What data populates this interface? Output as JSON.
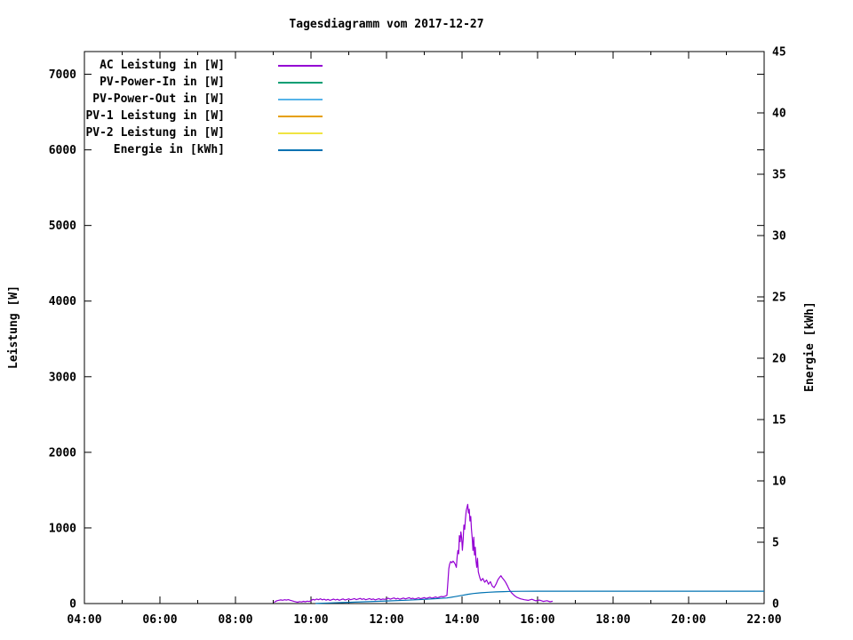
{
  "title": "Tagesdiagramm vom 2017-12-27",
  "chart_data": {
    "type": "line",
    "title": "Tagesdiagramm vom 2017-12-27",
    "x_axis": {
      "unit": "hour-of-day",
      "range": [
        4,
        22
      ],
      "major_hours": [
        4,
        6,
        8,
        10,
        12,
        14,
        16,
        18,
        20,
        22
      ],
      "major_labels": [
        "04:00",
        "06:00",
        "08:00",
        "10:00",
        "12:00",
        "14:00",
        "16:00",
        "18:00",
        "20:00",
        "22:00"
      ],
      "minor_hours": [
        5,
        7,
        9,
        11,
        13,
        15,
        17,
        19,
        21
      ]
    },
    "y1_axis": {
      "label": "Leistung [W]",
      "range": [
        0,
        7300
      ],
      "tick_values": [
        0,
        1000,
        2000,
        3000,
        4000,
        5000,
        6000,
        7000
      ],
      "tick_labels": [
        "0",
        "1000",
        "2000",
        "3000",
        "4000",
        "5000",
        "6000",
        "7000"
      ]
    },
    "y2_axis": {
      "label": "Energie [kWh]",
      "range": [
        0,
        45
      ],
      "tick_values": [
        0,
        5,
        10,
        15,
        20,
        25,
        30,
        35,
        40,
        45
      ],
      "tick_labels": [
        "0",
        "5",
        "10",
        "15",
        "20",
        "25",
        "30",
        "35",
        "40",
        "45"
      ]
    },
    "legend_position": "top-left-inside",
    "grid": false,
    "series": [
      {
        "name": "AC Leistung in [W]",
        "color": "#9400d3",
        "axis": "y1",
        "points": [
          [
            9.02,
            15
          ],
          [
            9.06,
            28
          ],
          [
            9.1,
            38
          ],
          [
            9.15,
            44
          ],
          [
            9.2,
            48
          ],
          [
            9.25,
            43
          ],
          [
            9.3,
            50
          ],
          [
            9.35,
            46
          ],
          [
            9.4,
            52
          ],
          [
            9.45,
            44
          ],
          [
            9.5,
            36
          ],
          [
            9.55,
            28
          ],
          [
            9.6,
            22
          ],
          [
            9.65,
            18
          ],
          [
            9.7,
            26
          ],
          [
            9.75,
            21
          ],
          [
            9.8,
            29
          ],
          [
            9.85,
            24
          ],
          [
            9.9,
            32
          ],
          [
            9.95,
            27
          ],
          [
            10.0,
            38
          ],
          [
            10.05,
            55
          ],
          [
            10.1,
            47
          ],
          [
            10.15,
            60
          ],
          [
            10.2,
            51
          ],
          [
            10.25,
            63
          ],
          [
            10.3,
            49
          ],
          [
            10.35,
            58
          ],
          [
            10.4,
            45
          ],
          [
            10.45,
            55
          ],
          [
            10.5,
            42
          ],
          [
            10.55,
            51
          ],
          [
            10.6,
            59
          ],
          [
            10.65,
            47
          ],
          [
            10.7,
            56
          ],
          [
            10.75,
            44
          ],
          [
            10.8,
            53
          ],
          [
            10.85,
            61
          ],
          [
            10.9,
            47
          ],
          [
            10.95,
            54
          ],
          [
            11.0,
            62
          ],
          [
            11.05,
            50
          ],
          [
            11.1,
            58
          ],
          [
            11.15,
            66
          ],
          [
            11.2,
            52
          ],
          [
            11.25,
            60
          ],
          [
            11.3,
            68
          ],
          [
            11.35,
            55
          ],
          [
            11.4,
            63
          ],
          [
            11.45,
            50
          ],
          [
            11.5,
            58
          ],
          [
            11.55,
            66
          ],
          [
            11.6,
            53
          ],
          [
            11.65,
            61
          ],
          [
            11.7,
            48
          ],
          [
            11.75,
            56
          ],
          [
            11.8,
            64
          ],
          [
            11.85,
            52
          ],
          [
            11.9,
            60
          ],
          [
            11.95,
            55
          ],
          [
            12.0,
            64
          ],
          [
            12.05,
            71
          ],
          [
            12.1,
            58
          ],
          [
            12.15,
            67
          ],
          [
            12.2,
            74
          ],
          [
            12.25,
            60
          ],
          [
            12.3,
            69
          ],
          [
            12.35,
            57
          ],
          [
            12.4,
            65
          ],
          [
            12.45,
            73
          ],
          [
            12.5,
            61
          ],
          [
            12.55,
            69
          ],
          [
            12.6,
            77
          ],
          [
            12.65,
            63
          ],
          [
            12.7,
            71
          ],
          [
            12.75,
            59
          ],
          [
            12.8,
            67
          ],
          [
            12.85,
            75
          ],
          [
            12.9,
            63
          ],
          [
            12.95,
            71
          ],
          [
            13.0,
            79
          ],
          [
            13.05,
            67
          ],
          [
            13.1,
            75
          ],
          [
            13.15,
            83
          ],
          [
            13.2,
            71
          ],
          [
            13.25,
            79
          ],
          [
            13.3,
            87
          ],
          [
            13.35,
            76
          ],
          [
            13.4,
            86
          ],
          [
            13.45,
            93
          ],
          [
            13.5,
            89
          ],
          [
            13.55,
            97
          ],
          [
            13.6,
            108
          ],
          [
            13.63,
            320
          ],
          [
            13.65,
            460
          ],
          [
            13.67,
            520
          ],
          [
            13.7,
            556
          ],
          [
            13.73,
            540
          ],
          [
            13.76,
            562
          ],
          [
            13.79,
            544
          ],
          [
            13.82,
            518
          ],
          [
            13.85,
            478
          ],
          [
            13.87,
            620
          ],
          [
            13.89,
            702
          ],
          [
            13.91,
            658
          ],
          [
            13.93,
            898
          ],
          [
            13.95,
            818
          ],
          [
            13.97,
            948
          ],
          [
            13.99,
            868
          ],
          [
            14.01,
            704
          ],
          [
            14.03,
            852
          ],
          [
            14.05,
            1038
          ],
          [
            14.07,
            982
          ],
          [
            14.09,
            1118
          ],
          [
            14.11,
            1228
          ],
          [
            14.13,
            1268
          ],
          [
            14.15,
            1312
          ],
          [
            14.17,
            1198
          ],
          [
            14.19,
            1246
          ],
          [
            14.21,
            1092
          ],
          [
            14.23,
            1152
          ],
          [
            14.25,
            980
          ],
          [
            14.27,
            858
          ],
          [
            14.29,
            702
          ],
          [
            14.31,
            878
          ],
          [
            14.33,
            642
          ],
          [
            14.35,
            744
          ],
          [
            14.37,
            562
          ],
          [
            14.39,
            478
          ],
          [
            14.41,
            598
          ],
          [
            14.43,
            420
          ],
          [
            14.45,
            382
          ],
          [
            14.47,
            342
          ],
          [
            14.5,
            302
          ],
          [
            14.55,
            332
          ],
          [
            14.6,
            282
          ],
          [
            14.65,
            312
          ],
          [
            14.7,
            256
          ],
          [
            14.75,
            290
          ],
          [
            14.8,
            232
          ],
          [
            14.85,
            212
          ],
          [
            14.9,
            258
          ],
          [
            14.95,
            316
          ],
          [
            15.0,
            350
          ],
          [
            15.03,
            368
          ],
          [
            15.06,
            344
          ],
          [
            15.1,
            318
          ],
          [
            15.15,
            284
          ],
          [
            15.2,
            238
          ],
          [
            15.25,
            186
          ],
          [
            15.3,
            148
          ],
          [
            15.35,
            122
          ],
          [
            15.4,
            100
          ],
          [
            15.45,
            84
          ],
          [
            15.55,
            62
          ],
          [
            15.65,
            50
          ],
          [
            15.75,
            42
          ],
          [
            15.85,
            56
          ],
          [
            15.95,
            36
          ],
          [
            16.05,
            46
          ],
          [
            16.15,
            28
          ],
          [
            16.25,
            38
          ],
          [
            16.33,
            24
          ],
          [
            16.4,
            30
          ]
        ]
      },
      {
        "name": "PV-Power-In in [W]",
        "color": "#009e73",
        "axis": "y1",
        "points": []
      },
      {
        "name": "PV-Power-Out in [W]",
        "color": "#56b4e9",
        "axis": "y1",
        "points": []
      },
      {
        "name": "PV-1 Leistung in [W]",
        "color": "#e69f00",
        "axis": "y1",
        "points": []
      },
      {
        "name": "PV-2 Leistung in [W]",
        "color": "#f0e442",
        "axis": "y1",
        "points": []
      },
      {
        "name": "Energie in [kWh]",
        "color": "#0072b2",
        "axis": "y2",
        "points": [
          [
            10.12,
            0.01
          ],
          [
            10.5,
            0.05
          ],
          [
            11.0,
            0.1
          ],
          [
            11.5,
            0.15
          ],
          [
            12.0,
            0.21
          ],
          [
            12.5,
            0.27
          ],
          [
            13.0,
            0.34
          ],
          [
            13.3,
            0.4
          ],
          [
            13.6,
            0.46
          ],
          [
            13.8,
            0.56
          ],
          [
            14.0,
            0.67
          ],
          [
            14.15,
            0.75
          ],
          [
            14.3,
            0.82
          ],
          [
            14.5,
            0.88
          ],
          [
            14.7,
            0.92
          ],
          [
            14.9,
            0.95
          ],
          [
            15.1,
            0.97
          ],
          [
            15.3,
            0.99
          ],
          [
            15.6,
            1.0
          ],
          [
            16.0,
            1.01
          ],
          [
            18.0,
            1.01
          ],
          [
            22.0,
            1.01
          ]
        ]
      }
    ]
  }
}
